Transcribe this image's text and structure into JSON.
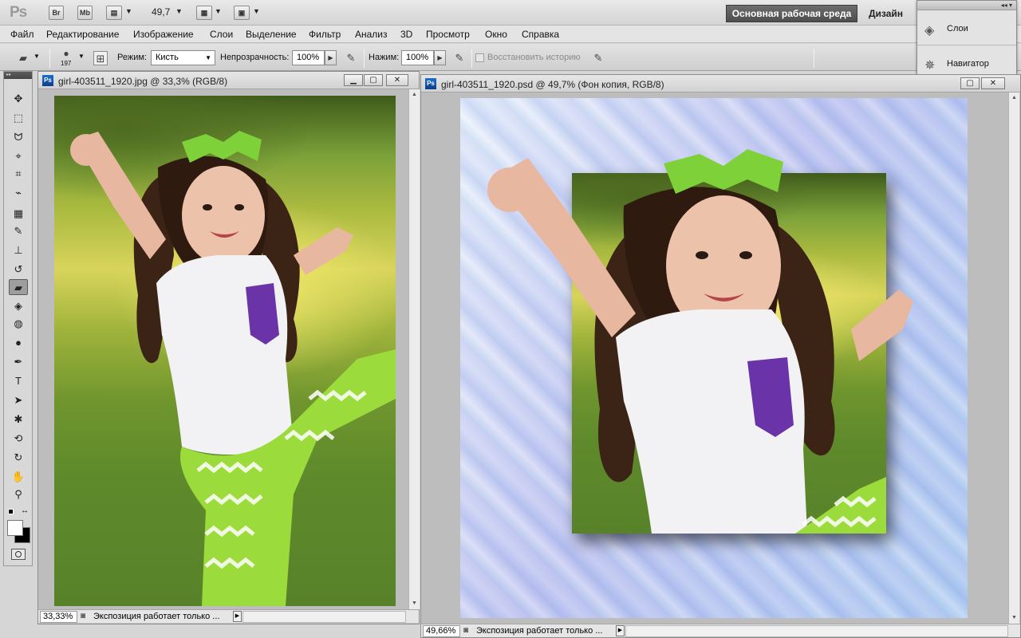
{
  "appbar": {
    "logo": "Ps",
    "bridge_label": "Br",
    "minibridge_label": "Mb",
    "zoom": "49,7",
    "workspace_active": "Основная рабочая среда",
    "workspace_design": "Дизайн"
  },
  "menu": [
    "Файл",
    "Редактирование",
    "Изображение",
    "Слои",
    "Выделение",
    "Фильтр",
    "Анализ",
    "3D",
    "Просмотр",
    "Окно",
    "Справка"
  ],
  "options": {
    "brush_size": "197",
    "mode_label": "Режим:",
    "mode_value": "Кисть",
    "opacity_label": "Непрозрачность:",
    "opacity_value": "100%",
    "flow_label": "Нажим:",
    "flow_value": "100%",
    "history_label": "Восстановить историю"
  },
  "panel": {
    "items": [
      {
        "label": "Слои",
        "icon": "layers-icon"
      },
      {
        "label": "Навигатор",
        "icon": "navigator-icon"
      }
    ]
  },
  "tools": [
    {
      "name": "move-tool",
      "glyph": "✥"
    },
    {
      "name": "marquee-tool",
      "glyph": "⬚"
    },
    {
      "name": "lasso-tool",
      "glyph": "ᗢ"
    },
    {
      "name": "quick-selection-tool",
      "glyph": "⌖"
    },
    {
      "name": "crop-tool",
      "glyph": "⌗"
    },
    {
      "name": "eyedropper-tool",
      "glyph": "⌁"
    },
    {
      "name": "healing-brush-tool",
      "glyph": "▦"
    },
    {
      "name": "brush-tool",
      "glyph": "✎"
    },
    {
      "name": "clone-stamp-tool",
      "glyph": "⊥"
    },
    {
      "name": "history-brush-tool",
      "glyph": "↺"
    },
    {
      "name": "eraser-tool",
      "glyph": "▰",
      "active": true
    },
    {
      "name": "paint-bucket-tool",
      "glyph": "◈"
    },
    {
      "name": "blur-tool",
      "glyph": "◍"
    },
    {
      "name": "dodge-tool",
      "glyph": "●"
    },
    {
      "name": "pen-tool",
      "glyph": "✒"
    },
    {
      "name": "type-tool",
      "glyph": "T"
    },
    {
      "name": "path-selection-tool",
      "glyph": "➤"
    },
    {
      "name": "shape-tool",
      "glyph": "✱"
    },
    {
      "name": "3d-rotate-tool",
      "glyph": "⟲"
    },
    {
      "name": "3d-orbit-tool",
      "glyph": "↻"
    },
    {
      "name": "hand-tool",
      "glyph": "✋"
    },
    {
      "name": "zoom-tool",
      "glyph": "⚲"
    }
  ],
  "doc1": {
    "title": "girl-403511_1920.jpg @ 33,3% (RGB/8)",
    "zoom": "33,33%",
    "status": "Экспозиция работает только ..."
  },
  "doc2": {
    "title": "girl-403511_1920.psd @ 49,7% (Фон копия, RGB/8)",
    "zoom": "49,66%",
    "status": "Экспозиция работает только ..."
  }
}
